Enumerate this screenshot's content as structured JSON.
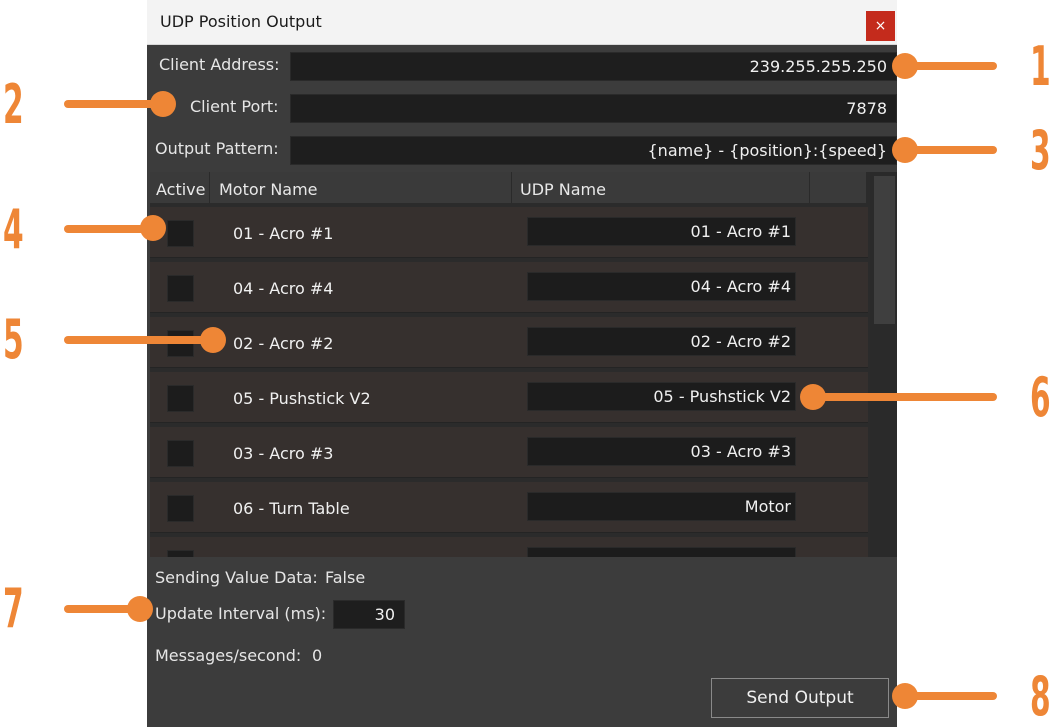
{
  "window": {
    "title": "UDP Position Output",
    "close_symbol": "×"
  },
  "form": {
    "client_address_label": "Client Address:",
    "client_address_value": "239.255.255.250",
    "client_port_label": "Client Port:",
    "client_port_value": "7878",
    "output_pattern_label": "Output Pattern:",
    "output_pattern_value": "{name} - {position}:{speed}"
  },
  "grid": {
    "headers": [
      "Active",
      "Motor Name",
      "UDP Name"
    ],
    "rows": [
      {
        "motor": "01 - Acro #1",
        "udp": "01 - Acro #1"
      },
      {
        "motor": "04 - Acro #4",
        "udp": "04 - Acro #4"
      },
      {
        "motor": "02 - Acro #2",
        "udp": "02 - Acro #2"
      },
      {
        "motor": "05 - Pushstick V2",
        "udp": "05 - Pushstick V2"
      },
      {
        "motor": "03 - Acro #3",
        "udp": "03 - Acro #3"
      },
      {
        "motor": "06 - Turn Table",
        "udp": "Motor"
      }
    ]
  },
  "status": {
    "sending_label": "Sending Value Data:",
    "sending_value": "False",
    "interval_label": "Update Interval (ms):",
    "interval_value": "30",
    "messages_label": "Messages/second:",
    "messages_value": "0"
  },
  "send_button": "Send Output",
  "callouts": [
    "1",
    "2",
    "3",
    "4",
    "5",
    "6",
    "7",
    "8"
  ],
  "colors": {
    "accent": "#ee8636",
    "close": "#c42b1c"
  }
}
